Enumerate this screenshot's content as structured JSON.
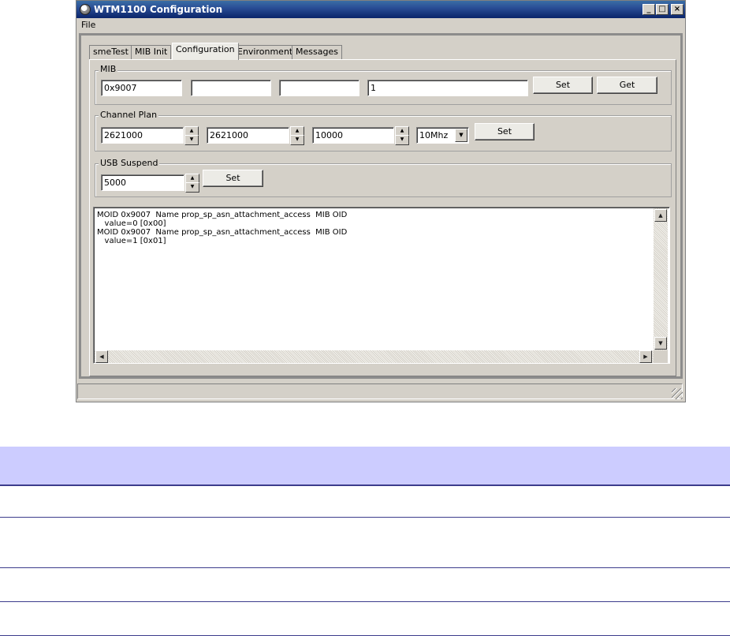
{
  "window": {
    "title": "WTM1100 Configuration",
    "controls": {
      "minimize": "_",
      "maximize": "□",
      "close": "×"
    }
  },
  "menu": {
    "file": "File"
  },
  "tabs": [
    {
      "label": "smeTest"
    },
    {
      "label": "MIB Init"
    },
    {
      "label": "Configuration",
      "active": true
    },
    {
      "label": "Environment"
    },
    {
      "label": "Messages"
    }
  ],
  "mib": {
    "title": "MIB",
    "field1": "0x9007",
    "field2": "",
    "field3": "",
    "field4": "1",
    "set_label": "Set",
    "get_label": "Get"
  },
  "channel_plan": {
    "title": "Channel Plan",
    "value1": "2621000",
    "value2": "2621000",
    "value3": "10000",
    "bandwidth": "10Mhz",
    "set_label": "Set"
  },
  "usb_suspend": {
    "title": "USB Suspend",
    "value": "5000",
    "set_label": "Set"
  },
  "log": {
    "lines": [
      "MOID 0x9007  Name prop_sp_asn_attachment_access  MIB OID",
      "   value=0 [0x00]",
      "MOID 0x9007  Name prop_sp_asn_attachment_access  MIB OID",
      "   value=1 [0x01]"
    ]
  },
  "icons": {
    "app": "app-icon",
    "spin_up": "▲",
    "spin_down": "▼",
    "combo_arrow": "▼",
    "scroll_up": "▲",
    "scroll_down": "▼",
    "scroll_left": "◀",
    "scroll_right": "▶"
  },
  "colors": {
    "titlebar": "#0a246a",
    "table_header": "#ccccff",
    "table_rule": "#3c3c8c"
  }
}
